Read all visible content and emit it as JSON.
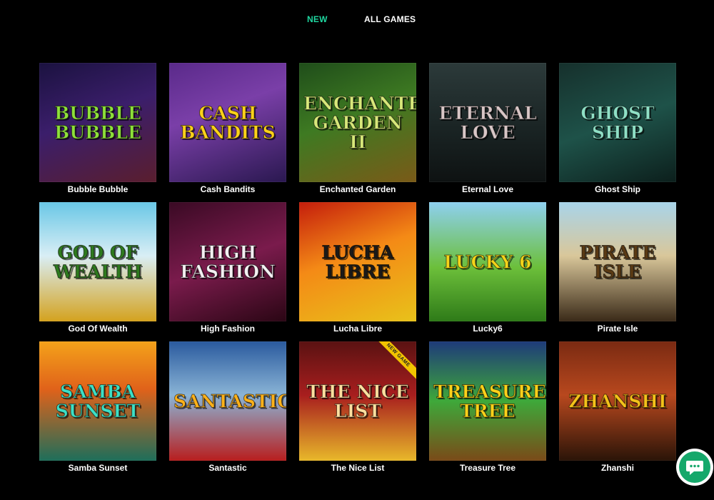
{
  "tabs": {
    "new_label": "NEW",
    "all_label": "ALL GAMES",
    "active_color": "#1fd7a0"
  },
  "games": [
    {
      "name": "Bubble Bubble",
      "art_text": "Bubble Bubble",
      "badge": "",
      "bg": "linear-gradient(160deg,#1b1240 0%,#3b1e6b 45%,#5a1e2e 100%)",
      "fg": "#8ee03a"
    },
    {
      "name": "Cash Bandits",
      "art_text": "Cash Bandits",
      "badge": "",
      "bg": "linear-gradient(160deg,#5a2a8a 0%,#7a3fa8 40%,#2a1850 100%)",
      "fg": "#ffd21a"
    },
    {
      "name": "Enchanted Garden",
      "art_text": "Enchanted Garden II",
      "badge": "",
      "bg": "linear-gradient(160deg,#1f4d1a 0%,#3e7a22 45%,#7a5a18 100%)",
      "fg": "#d8e87a"
    },
    {
      "name": "Eternal Love",
      "art_text": "Eternal Love",
      "badge": "",
      "bg": "linear-gradient(180deg,#2c3a3a 0%,#1a2424 55%,#0e1212 100%)",
      "fg": "#d8c6c6"
    },
    {
      "name": "Ghost Ship",
      "art_text": "Ghost Ship",
      "badge": "",
      "bg": "linear-gradient(160deg,#16302c 0%,#1e5249 50%,#0c1f1c 100%)",
      "fg": "#8fe0c6"
    },
    {
      "name": "God Of Wealth",
      "art_text": "God of Wealth",
      "badge": "",
      "bg": "linear-gradient(180deg,#69c7e6 0%,#d9eef5 45%,#d4a21e 100%)",
      "fg": "#2e7a1e"
    },
    {
      "name": "High Fashion",
      "art_text": "High Fashion",
      "badge": "",
      "bg": "linear-gradient(160deg,#3a0a24 0%,#7a1b4c 50%,#2a0614 100%)",
      "fg": "#f4f0f2"
    },
    {
      "name": "Lucha Libre",
      "art_text": "Lucha Libre",
      "badge": "",
      "bg": "linear-gradient(160deg,#c41d0c 0%,#f48a16 45%,#e8c21a 100%)",
      "fg": "#1a1a1a"
    },
    {
      "name": "Lucky6",
      "art_text": "Lucky 6",
      "badge": "",
      "bg": "linear-gradient(180deg,#8ed0f0 0%,#6cbf3a 55%,#2e7a18 100%)",
      "fg": "#f4d41a"
    },
    {
      "name": "Pirate Isle",
      "art_text": "Pirate Isle",
      "badge": "",
      "bg": "linear-gradient(180deg,#a8d4ea 0%,#d9c79a 45%,#3a2a18 100%)",
      "fg": "#5a3a14"
    },
    {
      "name": "Samba Sunset",
      "art_text": "Samba Sunset",
      "badge": "",
      "bg": "linear-gradient(180deg,#f4a21a 0%,#e0621a 40%,#1e6e5a 100%)",
      "fg": "#3ee0c6"
    },
    {
      "name": "Santastic",
      "art_text": "Santastic!",
      "badge": "",
      "bg": "linear-gradient(180deg,#2a5a9e 0%,#8ab4d6 45%,#b81e1e 100%)",
      "fg": "#ffb21a"
    },
    {
      "name": "The Nice List",
      "art_text": "The Nice List",
      "badge": "NEW GAME",
      "bg": "linear-gradient(180deg,#5a1212 0%,#a81e1e 45%,#e8b82a 100%)",
      "fg": "#ffe0a0"
    },
    {
      "name": "Treasure Tree",
      "art_text": "Treasure Tree",
      "badge": "",
      "bg": "linear-gradient(180deg,#1e3a7a 0%,#3ea83a 50%,#7a4a18 100%)",
      "fg": "#ffd21a"
    },
    {
      "name": "Zhanshi",
      "art_text": "Zhanshi",
      "badge": "",
      "bg": "linear-gradient(180deg,#7a2a12 0%,#b8481e 45%,#2a1408 100%)",
      "fg": "#f4c21a"
    }
  ],
  "chat": {
    "icon": "chat-icon"
  }
}
